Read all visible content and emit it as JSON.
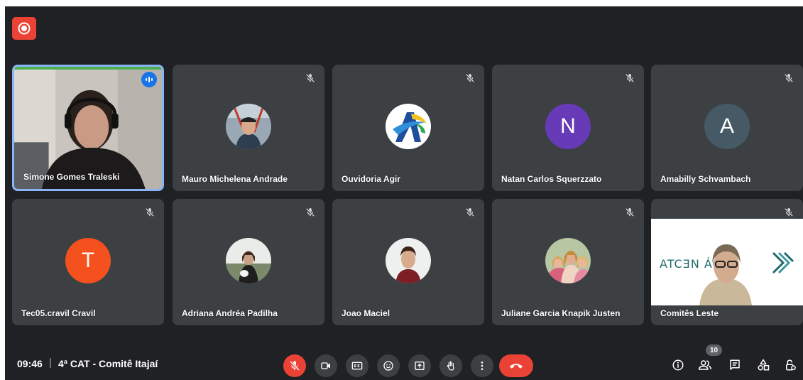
{
  "colors": {
    "background": "#202124",
    "tile": "#3c4043",
    "accent_red": "#ea4335",
    "speaking_border": "#8ab4f8",
    "avatar_purple": "#673ab7",
    "avatar_slate": "#455a64",
    "avatar_orange": "#f4511e"
  },
  "participants": [
    {
      "name": "Simone Gomes Traleski",
      "muted": false,
      "speaking": true,
      "media": "camera"
    },
    {
      "name": "Mauro Michelena Andrade",
      "muted": true,
      "media": "photo"
    },
    {
      "name": "Ouvidoria Agir",
      "muted": true,
      "media": "logo"
    },
    {
      "name": "Natan Carlos Squerzzato",
      "muted": true,
      "media": "initial",
      "initial": "N"
    },
    {
      "name": "Amabilly Schvambach",
      "muted": true,
      "media": "initial",
      "initial": "A"
    },
    {
      "name": "Tec05.cravil Cravil",
      "muted": true,
      "media": "initial",
      "initial": "T"
    },
    {
      "name": "Adriana Andréa Padilha",
      "muted": true,
      "media": "photo"
    },
    {
      "name": "Joao Maciel",
      "muted": true,
      "media": "photo"
    },
    {
      "name": "Juliane Garcia Knapik Justen",
      "muted": true,
      "media": "photo"
    },
    {
      "name": "Comitês Leste",
      "muted": true,
      "media": "camera",
      "background_text": "ATCƎN ÁGUA"
    }
  ],
  "bottom_bar": {
    "time": "09:46",
    "separator": "|",
    "meeting_title": "4ª CAT - Comitê Itajaí",
    "participant_count": "10"
  },
  "icons": {
    "record": "record-icon",
    "mic_off": "mic-off-icon",
    "camera": "camera-icon",
    "captions": "captions-icon",
    "emoji": "emoji-icon",
    "present": "present-icon",
    "raise_hand": "raise-hand-icon",
    "more": "more-options-icon",
    "end_call": "end-call-icon",
    "info": "info-icon",
    "people": "people-icon",
    "chat": "chat-icon",
    "activities": "activities-icon",
    "host_controls": "host-controls-icon"
  }
}
